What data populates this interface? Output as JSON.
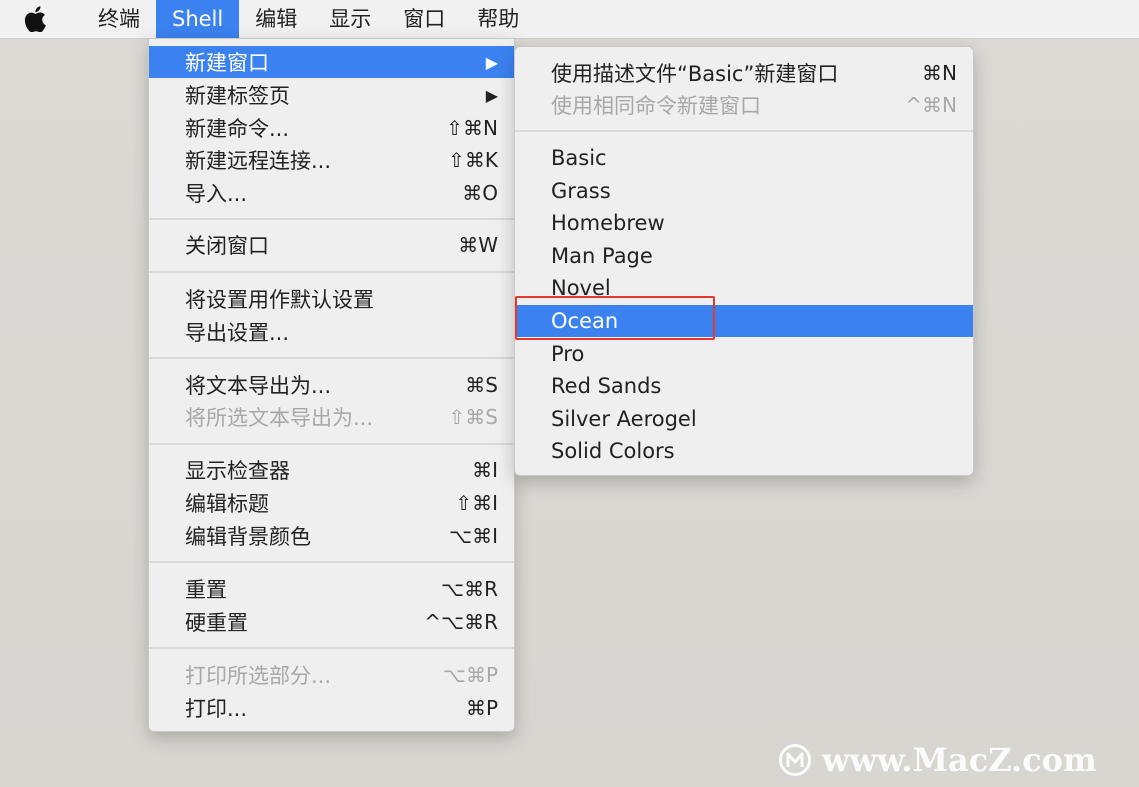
{
  "menubar": {
    "apple_icon": "apple-logo",
    "items": [
      "终端",
      "Shell",
      "编辑",
      "显示",
      "窗口",
      "帮助"
    ],
    "active": "Shell"
  },
  "shell_menu": {
    "items": [
      {
        "label": "新建窗口",
        "shortcut": "▶",
        "highlighted": true
      },
      {
        "label": "新建标签页",
        "shortcut": "▶"
      },
      {
        "label": "新建命令...",
        "shortcut": "⇧⌘N"
      },
      {
        "label": "新建远程连接...",
        "shortcut": "⇧⌘K"
      },
      {
        "label": "导入...",
        "shortcut": "⌘O"
      },
      {
        "label": "关闭窗口",
        "shortcut": "⌘W"
      },
      {
        "label": "将设置用作默认设置",
        "shortcut": ""
      },
      {
        "label": "导出设置...",
        "shortcut": ""
      },
      {
        "label": "将文本导出为...",
        "shortcut": "⌘S"
      },
      {
        "label": "将所选文本导出为...",
        "shortcut": "⇧⌘S",
        "disabled": true
      },
      {
        "label": "显示检查器",
        "shortcut": "⌘I"
      },
      {
        "label": "编辑标题",
        "shortcut": "⇧⌘I"
      },
      {
        "label": "编辑背景颜色",
        "shortcut": "⌥⌘I"
      },
      {
        "label": "重置",
        "shortcut": "⌥⌘R"
      },
      {
        "label": "硬重置",
        "shortcut": "^⌥⌘R"
      },
      {
        "label": "打印所选部分...",
        "shortcut": "⌥⌘P",
        "disabled": true
      },
      {
        "label": "打印...",
        "shortcut": "⌘P"
      }
    ]
  },
  "submenu": {
    "items": [
      {
        "label": "使用描述文件“Basic”新建窗口",
        "shortcut": "⌘N"
      },
      {
        "label": "使用相同命令新建窗口",
        "shortcut": "^⌘N",
        "disabled": true
      },
      {
        "label": "Basic",
        "shortcut": ""
      },
      {
        "label": "Grass",
        "shortcut": ""
      },
      {
        "label": "Homebrew",
        "shortcut": ""
      },
      {
        "label": "Man Page",
        "shortcut": ""
      },
      {
        "label": "Novel",
        "shortcut": ""
      },
      {
        "label": "Ocean",
        "shortcut": "",
        "highlighted": true
      },
      {
        "label": "Pro",
        "shortcut": ""
      },
      {
        "label": "Red Sands",
        "shortcut": ""
      },
      {
        "label": "Silver Aerogel",
        "shortcut": ""
      },
      {
        "label": "Solid Colors",
        "shortcut": ""
      }
    ]
  },
  "watermark": {
    "text": "www.MacZ.com",
    "icon": "macz-logo"
  },
  "colors": {
    "highlight": "#3b82f0",
    "annotation_box": "#e23a2e"
  }
}
